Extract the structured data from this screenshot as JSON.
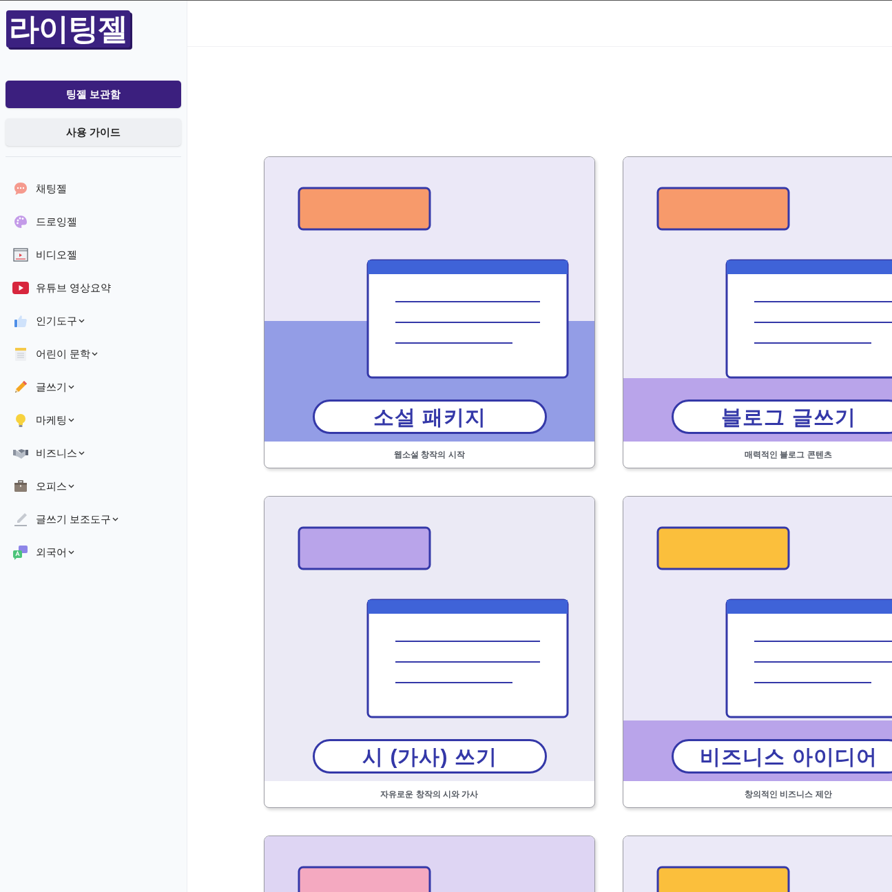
{
  "logo": {
    "text": "라이팅젤"
  },
  "sidebar": {
    "buttons": [
      {
        "label": "팅젤 보관함",
        "kind": "primary"
      },
      {
        "label": "사용 가이드",
        "kind": "secondary"
      }
    ],
    "items": [
      {
        "label": "채팅젤",
        "has_submenu": false
      },
      {
        "label": "드로잉젤",
        "has_submenu": false
      },
      {
        "label": "비디오젤",
        "has_submenu": false
      },
      {
        "label": "유튜브 영상요약",
        "has_submenu": false
      },
      {
        "label": "인기도구",
        "has_submenu": true
      },
      {
        "label": "어린이 문학",
        "has_submenu": true
      },
      {
        "label": "글쓰기",
        "has_submenu": true
      },
      {
        "label": "마케팅",
        "has_submenu": true
      },
      {
        "label": "비즈니스",
        "has_submenu": true
      },
      {
        "label": "오피스",
        "has_submenu": true
      },
      {
        "label": "글쓰기 보조도구",
        "has_submenu": true
      },
      {
        "label": "외국어",
        "has_submenu": true
      }
    ]
  },
  "cards": [
    {
      "kind": "titled",
      "title": "소설 패키지",
      "caption": "웹소설 창작의 시작"
    },
    {
      "kind": "titled",
      "title": "블로그 글쓰기",
      "caption": "매력적인 블로그 콘텐츠"
    },
    {
      "kind": "titled",
      "title": "시 (가사) 쓰기",
      "caption": "자유로운 창작의 시와 가사"
    },
    {
      "kind": "titled",
      "title": "비즈니스 아이디어",
      "caption": "창의적인 비즈니스 제안"
    },
    {
      "kind": "illustration"
    },
    {
      "kind": "illustration"
    }
  ]
}
